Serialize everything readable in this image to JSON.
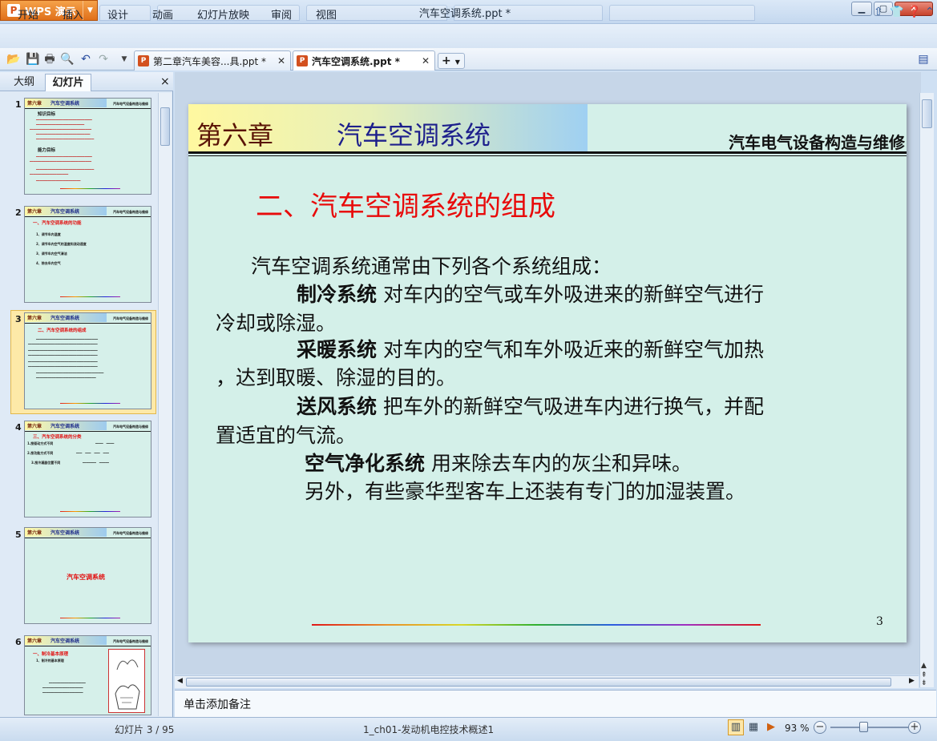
{
  "app": {
    "button_label": "WPS 演示",
    "logo_glyph": "P",
    "window_title": "汽车空调系统.ppt *"
  },
  "menu": {
    "items": [
      "开始",
      "插入",
      "设计",
      "动画",
      "幻灯片放映",
      "审阅",
      "视图"
    ]
  },
  "doc_tabs": [
    {
      "label": "第二章汽车美容...具.ppt *"
    },
    {
      "label": "汽车空调系统.ppt *"
    }
  ],
  "panel": {
    "tabs": [
      "大纲",
      "幻灯片"
    ],
    "active_tab": 1,
    "close_glyph": "×"
  },
  "thumbnails": [
    {
      "num": "1",
      "head_a": "第六章",
      "head_b": "汽车空调系统",
      "head_c": "汽车电气设备构造与维修",
      "title": "知识目标",
      "title2": "能力目标"
    },
    {
      "num": "2",
      "head_a": "第六章",
      "head_b": "汽车空调系统",
      "head_c": "汽车电气设备构造与维修",
      "title": "一、汽车空调系统的功能",
      "lines": [
        "1、调节车内温度",
        "2、调节车内空气的湿度和流动速度",
        "3、调节车内空气清洁",
        "4、除去车内空气"
      ]
    },
    {
      "num": "3",
      "head_a": "第六章",
      "head_b": "汽车空调系统",
      "head_c": "汽车电气设备构造与维修",
      "title": "二、汽车空调系统的组成"
    },
    {
      "num": "4",
      "head_a": "第六章",
      "head_b": "汽车空调系统",
      "head_c": "汽车电气设备构造与维修",
      "title": "三、汽车空调系统的分类",
      "lines": [
        "1.按驱动方式不同",
        "2.按功能方式不同",
        "3.按冷凝器位置不同"
      ]
    },
    {
      "num": "5",
      "head_a": "第六章",
      "head_b": "汽车空调系统",
      "head_c": "汽车电气设备构造与维修",
      "title": "汽车空调系统"
    },
    {
      "num": "6",
      "head_a": "第六章",
      "head_b": "汽车空调系统",
      "head_c": "汽车电气设备构造与维修",
      "title": "一、制冷基本原理",
      "lines": [
        "1、制冷的基本原理"
      ]
    }
  ],
  "slide": {
    "chapter": "第六章",
    "chapter_title": "汽车空调系统",
    "course": "汽车电气设备构造与维修",
    "heading": "二、汽车空调系统的组成",
    "intro": "汽车空调系统通常由下列各个系统组成：",
    "p1_term": "制冷系统",
    "p1_rest": "  对车内的空气或车外吸进来的新鲜空气进行",
    "p1_cont": "冷却或除湿。",
    "p2_term": "采暖系统",
    "p2_rest": "  对车内的空气和车外吸近来的新鲜空气加热",
    "p2_cont": "，达到取暖、除湿的目的。",
    "p3_term": "送风系统",
    "p3_rest": "  把车外的新鲜空气吸进车内进行换气，并配",
    "p3_cont": "置适宜的气流。",
    "p4_term": "空气净化系统",
    "p4_rest": "  用来除去车内的灰尘和异味。",
    "p5": "另外，有些豪华型客车上还装有专门的加湿装置。",
    "page_number": "3"
  },
  "notes": {
    "placeholder": "单击添加备注"
  },
  "status": {
    "slide_counter": "幻灯片 3 / 95",
    "template": "1_ch01-发动机电控技术概述1",
    "zoom": "93 %"
  },
  "colors": {
    "slide_bg": "#d4f0e9",
    "heading_red": "#e80a0a",
    "chapter_blue": "#1d1f8c",
    "wps_orange": "#e0701a"
  }
}
